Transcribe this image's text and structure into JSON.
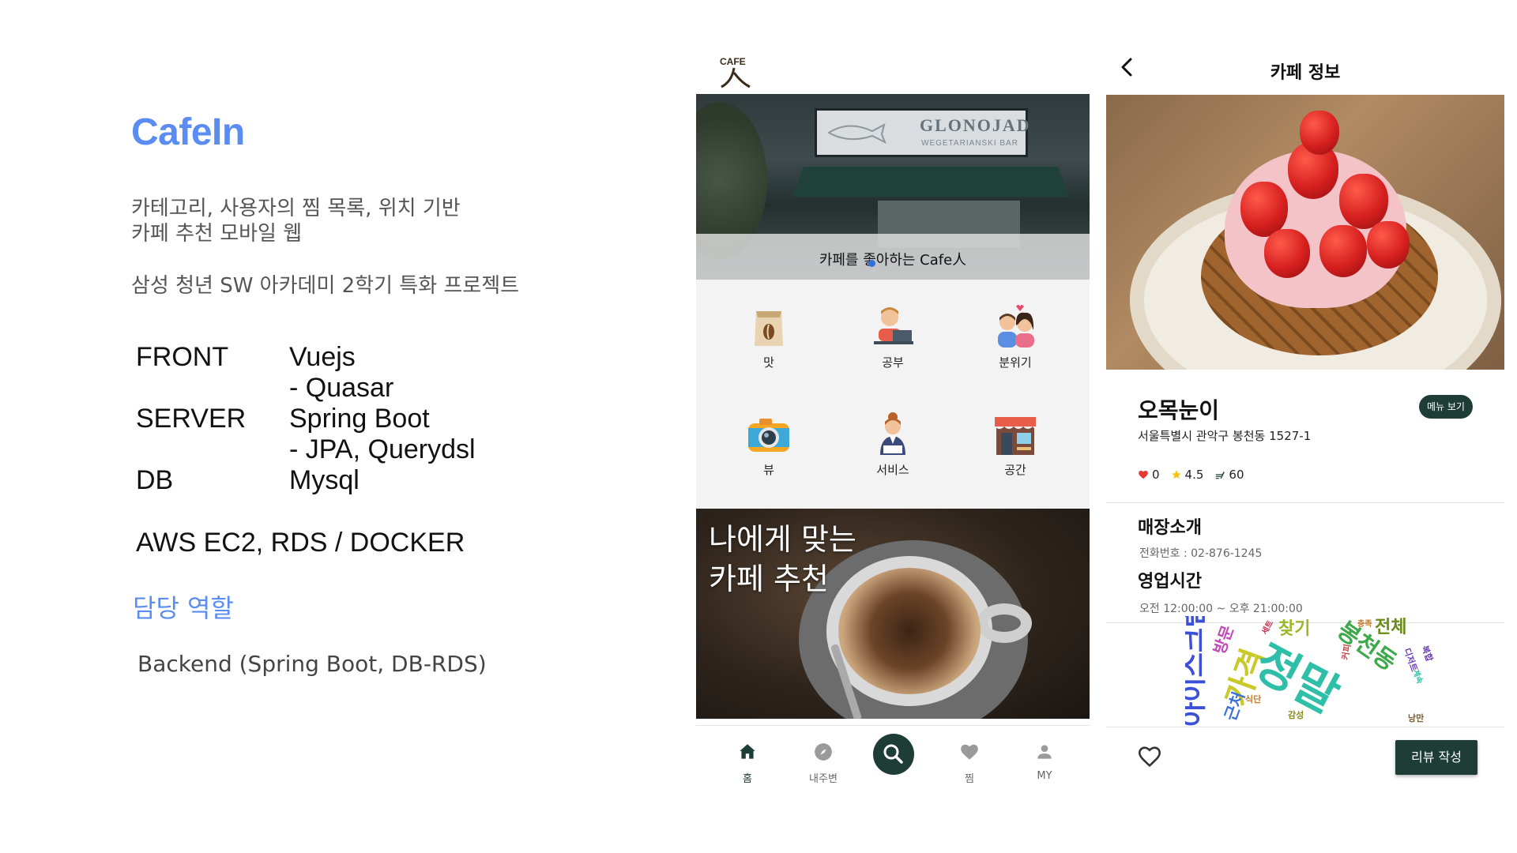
{
  "slide": {
    "title": "CafeIn",
    "desc_line1": "카테고리, 사용자의 찜 목록, 위치 기반",
    "desc_line2": "카페 추천 모바일 웹",
    "desc_line3": "삼성 청년 SW 아카데미 2학기 특화 프로젝트",
    "stack": [
      {
        "key": "FRONT",
        "value": "Vuejs"
      },
      {
        "key": "",
        "value": "- Quasar"
      },
      {
        "key": "SERVER",
        "value": "Spring Boot"
      },
      {
        "key": "",
        "value": "- JPA, Querydsl"
      },
      {
        "key": "DB",
        "value": "Mysql"
      }
    ],
    "infra": "AWS EC2, RDS  / DOCKER",
    "role_title": "담당 역할",
    "role_desc": "Backend (Spring Boot, DB-RDS)"
  },
  "home": {
    "logo_text": "CAFE",
    "hero_sign": "GLONOJAD",
    "hero_sign_sub": "WEGETARIANSKI BAR",
    "hero_caption": "카페를 좋아하는 Cafe人",
    "categories": [
      {
        "label": "맛",
        "icon": "coffee-bag-icon"
      },
      {
        "label": "공부",
        "icon": "study-icon"
      },
      {
        "label": "분위기",
        "icon": "couple-icon"
      },
      {
        "label": "뷰",
        "icon": "camera-icon"
      },
      {
        "label": "서비스",
        "icon": "staff-icon"
      },
      {
        "label": "공간",
        "icon": "shop-icon"
      }
    ],
    "banner_line1": "나에게 맞는",
    "banner_line2": "카페 추천",
    "nav": [
      {
        "label": "홈",
        "icon": "home-icon",
        "active": true
      },
      {
        "label": "내주변",
        "icon": "compass-icon"
      },
      {
        "label": "",
        "icon": "search-icon"
      },
      {
        "label": "찜",
        "icon": "heart-icon"
      },
      {
        "label": "MY",
        "icon": "person-icon"
      }
    ]
  },
  "detail": {
    "title": "카페 정보",
    "shop_name": "오목눈이",
    "address": "서울특별시 관악구 봉천동 1527-1",
    "menu_button": "메뉴 보기",
    "likes": "0",
    "rating": "4.5",
    "reviews": "60",
    "intro_title": "매장소개",
    "phone": "전화번호 : 02-876-1245",
    "hours_title": "영업시간",
    "hours": "오전 12:00:00 ~ 오후 21:00:00",
    "review_button": "리뷰 작성",
    "wordcloud": [
      "아이스크림",
      "가격",
      "정말",
      "봉천동",
      "찾기",
      "전체",
      "방문",
      "커피",
      "근처",
      "충족",
      "세트",
      "디저트",
      "식단",
      "감성",
      "낭만",
      "분위기",
      "복합",
      "계속"
    ]
  },
  "colors": {
    "accent": "#5b8cf2",
    "brand_dark": "#1f3d37",
    "heart": "#e53935",
    "star": "#f4c20d"
  }
}
